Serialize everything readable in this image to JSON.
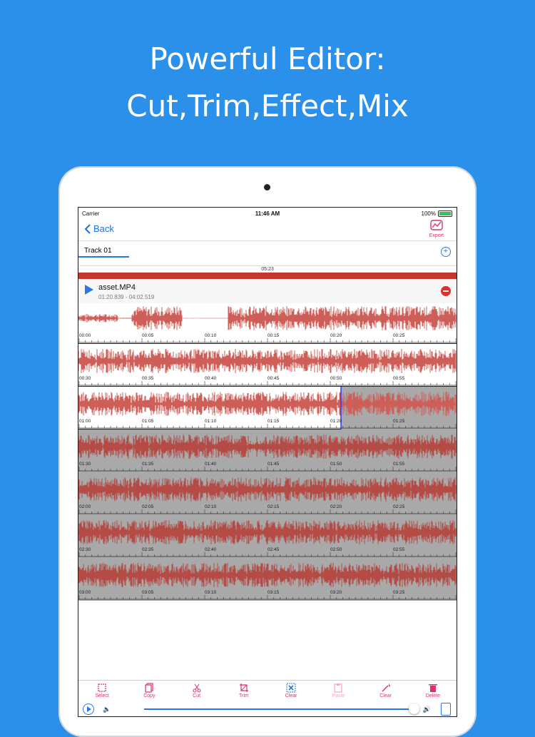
{
  "headline": {
    "line1": "Powerful Editor:",
    "line2": "Cut,Trim,Effect,Mix"
  },
  "status": {
    "carrier": "Carrier",
    "time": "11:46 AM",
    "battery": "100%"
  },
  "nav": {
    "back": "Back",
    "export": "Export"
  },
  "track": {
    "tab": "Track 01",
    "duration": "05:23"
  },
  "asset": {
    "name": "asset.MP4",
    "range": "01:20.839 - 04:02.519"
  },
  "rows": [
    [
      "00:00",
      "00:05",
      "00:10",
      "00:15",
      "00:20",
      "00:25"
    ],
    [
      "00:30",
      "00:35",
      "00:40",
      "00:45",
      "00:50",
      "00:55"
    ],
    [
      "01:00",
      "01:05",
      "01:10",
      "01:15",
      "01:20",
      "01:25"
    ],
    [
      "01:30",
      "01:35",
      "01:40",
      "01:45",
      "01:50",
      "01:55"
    ],
    [
      "02:00",
      "02:05",
      "02:10",
      "02:15",
      "02:20",
      "02:25"
    ],
    [
      "02:30",
      "02:35",
      "02:40",
      "02:45",
      "02:50",
      "02:55"
    ],
    [
      "03:00",
      "03:05",
      "03:10",
      "03:15",
      "03:20",
      "03:25"
    ]
  ],
  "toolbar": [
    {
      "label": "Select",
      "icon": "select-icon",
      "disabled": false
    },
    {
      "label": "Copy",
      "icon": "copy-icon",
      "disabled": false
    },
    {
      "label": "Cut",
      "icon": "scissors-icon",
      "disabled": false
    },
    {
      "label": "Trim",
      "icon": "trim-icon",
      "disabled": false
    },
    {
      "label": "Clear",
      "icon": "clear-x-icon",
      "disabled": false
    },
    {
      "label": "Paste",
      "icon": "paste-icon",
      "disabled": true
    },
    {
      "label": "Clear",
      "icon": "magic-wand-icon",
      "disabled": false
    },
    {
      "label": "Delete",
      "icon": "trash-icon",
      "disabled": false
    }
  ],
  "colors": {
    "waveform": "#cd5f58",
    "selection_bg": "#a9a9a9",
    "accent": "#2b78e4",
    "toolbar": "#e0306b",
    "background": "#2b90ea"
  },
  "volume": 0.9
}
